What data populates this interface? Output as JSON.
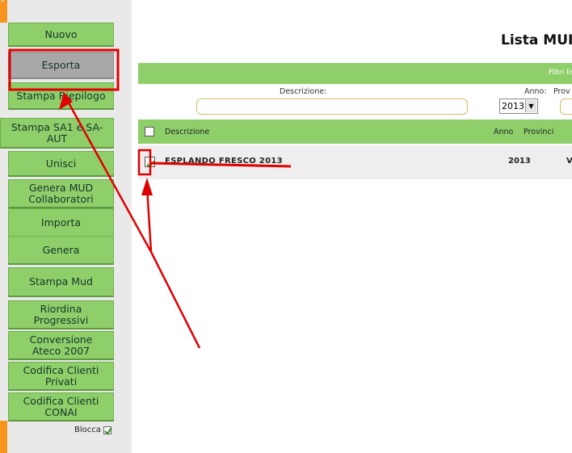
{
  "sidebar": {
    "corner_mark": "*",
    "items": [
      {
        "label_1": "Nuovo",
        "label_2": ""
      },
      {
        "label_1": "Esporta",
        "label_2": ""
      },
      {
        "label_1": "Stampa Riepilogo",
        "label_2": ""
      },
      {
        "label_1": "Stampa SA1 e SA-",
        "label_2": "AUT"
      },
      {
        "label_1": "Unisci",
        "label_2": ""
      },
      {
        "label_1": "Genera MUD",
        "label_2": "Collaboratori"
      },
      {
        "label_1": "Importa",
        "label_2": ""
      },
      {
        "label_1": "Genera",
        "label_2": ""
      },
      {
        "label_1": "Stampa Mud",
        "label_2": ""
      },
      {
        "label_1": "Riordina",
        "label_2": "Progressivi"
      },
      {
        "label_1": "Conversione",
        "label_2": "Ateco 2007"
      },
      {
        "label_1": "Codifica Clienti",
        "label_2": "Privati"
      },
      {
        "label_1": "Codifica Clienti",
        "label_2": "CONAI"
      }
    ],
    "blocca_label": "Blocca"
  },
  "main": {
    "title": "Lista MUI",
    "filter_bar_label": "Filtri lis",
    "filters": {
      "descrizione_label": "Descrizione:",
      "descrizione_value": "",
      "anno_label": "Anno:",
      "anno_value": "2013",
      "provincia_label": "Prov"
    },
    "table": {
      "headers": {
        "descrizione": "Descrizione",
        "anno": "Anno",
        "provincia": "Provinci"
      },
      "rows": [
        {
          "descrizione": "ESPLANDO FRESCO 2013",
          "anno": "2013",
          "provincia": "V",
          "checked": true
        }
      ]
    }
  },
  "colors": {
    "menu_green": "#8fcf6a",
    "selected_gray": "#a8a8a8",
    "annotation_red": "#e00000",
    "orange": "#f7941d"
  }
}
